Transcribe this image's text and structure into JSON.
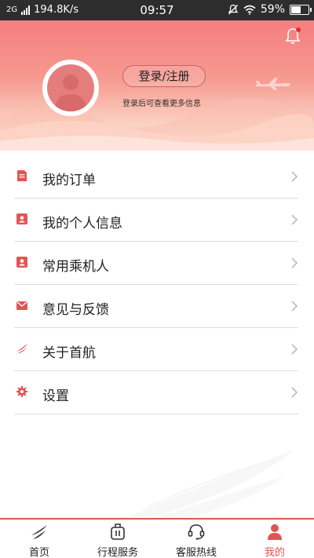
{
  "status_bar": {
    "network": "2G",
    "speed": "194.8K/s",
    "time": "09:57",
    "battery": "59%",
    "battery_level": 0.59
  },
  "header": {
    "login_label": "登录/注册",
    "login_hint": "登录后可查看更多信息",
    "notification_dot_color": "#e02b2b"
  },
  "menu": {
    "items": [
      {
        "label": "我的订单",
        "icon": "order-icon"
      },
      {
        "label": "我的个人信息",
        "icon": "profile-card-icon"
      },
      {
        "label": "常用乘机人",
        "icon": "passenger-icon"
      },
      {
        "label": "意见与反馈",
        "icon": "envelope-icon"
      },
      {
        "label": "关于首航",
        "icon": "airline-logo-icon"
      },
      {
        "label": "设置",
        "icon": "gear-icon"
      }
    ]
  },
  "tabbar": {
    "tabs": [
      {
        "label": "首页",
        "icon": "airline-logo-icon"
      },
      {
        "label": "行程服务",
        "icon": "luggage-icon"
      },
      {
        "label": "客服热线",
        "icon": "headset-icon"
      },
      {
        "label": "我的",
        "icon": "user-icon"
      }
    ],
    "active_index": 3
  },
  "colors": {
    "accent": "#e25454",
    "header_top": "#f47e7e",
    "header_bottom": "#fde6dc"
  }
}
